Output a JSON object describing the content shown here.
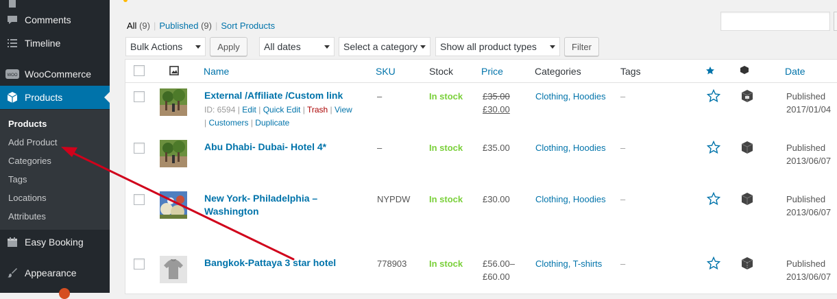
{
  "sidebar": {
    "items": [
      {
        "label": "Comments",
        "icon": "comment-bubble-icon"
      },
      {
        "label": "Timeline",
        "icon": "list-icon"
      },
      {
        "label": "WooCommerce",
        "icon": "woocommerce-icon"
      },
      {
        "label": "Products",
        "icon": "box-icon"
      },
      {
        "label": "Easy Booking",
        "icon": "calendar-icon"
      },
      {
        "label": "Appearance",
        "icon": "paintbrush-icon"
      }
    ],
    "submenu": [
      "Products",
      "Add Product",
      "Categories",
      "Tags",
      "Locations",
      "Attributes"
    ]
  },
  "views": {
    "all_label": "All",
    "all_count": "(9)",
    "published_label": "Published",
    "published_count": "(9)",
    "sort_label": "Sort Products"
  },
  "filters": {
    "bulk_actions": "Bulk Actions",
    "apply": "Apply",
    "dates": "All dates",
    "category": "Select a category",
    "product_type": "Show all product types",
    "filter": "Filter"
  },
  "columns": {
    "name": "Name",
    "sku": "SKU",
    "stock": "Stock",
    "price": "Price",
    "categories": "Categories",
    "tags": "Tags",
    "date": "Date"
  },
  "rows": [
    {
      "name": "External /Affiliate /Custom link",
      "actions": {
        "id": "ID: 6594",
        "edit": "Edit",
        "quick_edit": "Quick Edit",
        "trash": "Trash",
        "view": "View",
        "customers": "Customers",
        "duplicate": "Duplicate"
      },
      "sku": "–",
      "stock": "In stock",
      "price_old": "£35.00",
      "price_new": "£30.00",
      "categories": "Clothing, Hoodies",
      "tags": "–",
      "status": "Published",
      "date": "2017/01/04"
    },
    {
      "name": "Abu Dhabi- Dubai- Hotel 4*",
      "sku": "–",
      "stock": "In stock",
      "price": "£35.00",
      "categories": "Clothing, Hoodies",
      "tags": "–",
      "status": "Published",
      "date": "2013/06/07"
    },
    {
      "name_line1": "New York- Philadelphia –",
      "name_line2": "Washington",
      "sku": "NYPDW",
      "stock": "In stock",
      "price": "£30.00",
      "categories": "Clothing, Hoodies",
      "tags": "–",
      "status": "Published",
      "date": "2013/06/07"
    },
    {
      "name": "Bangkok-Pattaya 3 star hotel",
      "sku": "778903",
      "stock": "In stock",
      "price_line1": "£56.00–",
      "price_line2": "£60.00",
      "categories": "Clothing, T-shirts",
      "tags": "–",
      "status": "Published",
      "date": "2013/06/07"
    }
  ],
  "colors": {
    "sidebar": "#23282d",
    "active": "#0073aa",
    "link": "#0073aa",
    "in_stock": "#7ad03a",
    "annotation_arrow": "#d0021b"
  }
}
